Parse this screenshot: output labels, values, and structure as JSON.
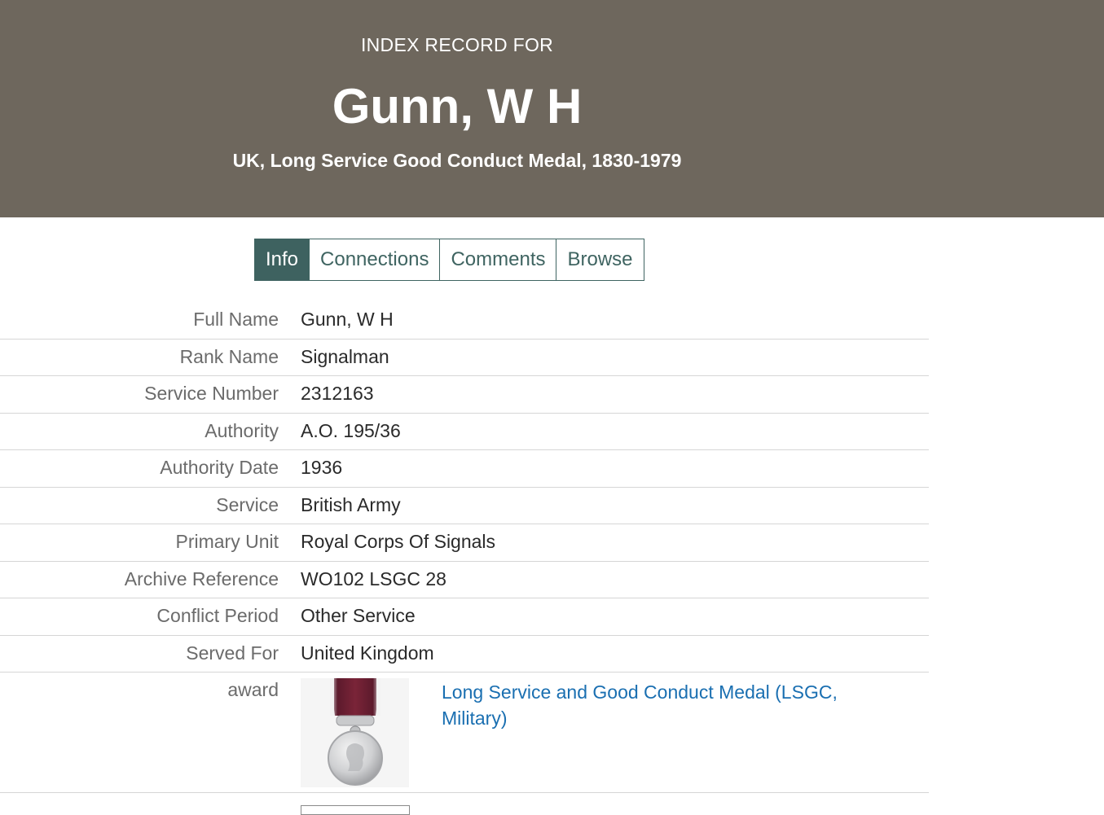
{
  "header": {
    "eyebrow": "INDEX RECORD FOR",
    "name": "Gunn, W H",
    "collection": "UK, Long Service Good Conduct Medal, 1830-1979"
  },
  "tabs": [
    {
      "label": "Info",
      "active": true
    },
    {
      "label": "Connections",
      "active": false
    },
    {
      "label": "Comments",
      "active": false
    },
    {
      "label": "Browse",
      "active": false
    }
  ],
  "details": [
    {
      "label": "Full Name",
      "value": "Gunn, W H"
    },
    {
      "label": "Rank Name",
      "value": "Signalman"
    },
    {
      "label": "Service Number",
      "value": "2312163"
    },
    {
      "label": "Authority",
      "value": "A.O. 195/36"
    },
    {
      "label": "Authority Date",
      "value": "1936"
    },
    {
      "label": "Service",
      "value": "British Army"
    },
    {
      "label": "Primary Unit",
      "value": "Royal Corps Of Signals"
    },
    {
      "label": "Archive Reference",
      "value": "WO102 LSGC 28"
    },
    {
      "label": "Conflict Period",
      "value": "Other Service"
    },
    {
      "label": "Served For",
      "value": "United Kingdom"
    }
  ],
  "award": {
    "label": "award",
    "link": "Long Service and Good Conduct Medal (LSGC, Military)",
    "image_icon": "medal-image"
  },
  "colors": {
    "header_bg": "#6e675d",
    "tab_active_bg": "#3e6260",
    "tab_border": "#3f6461",
    "link": "#1a6fb1"
  }
}
